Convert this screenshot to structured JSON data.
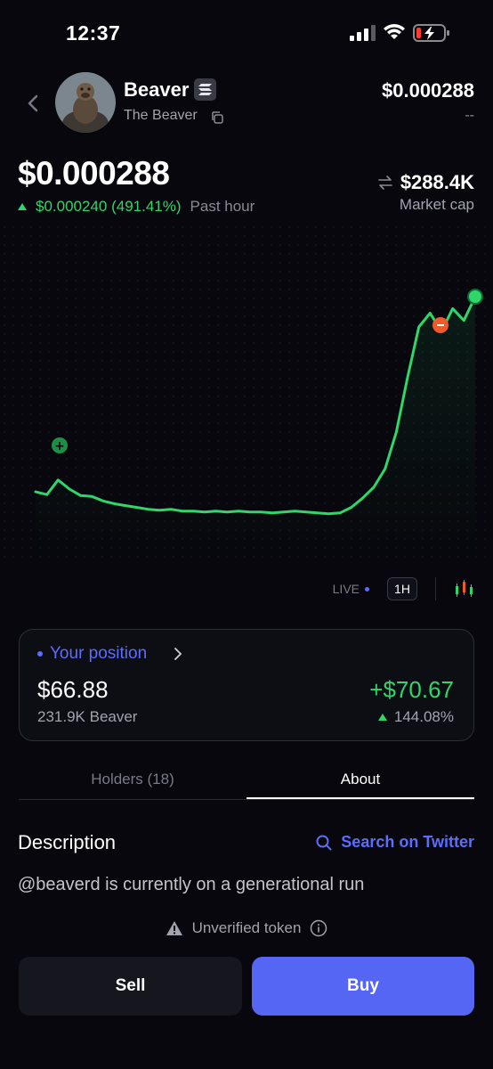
{
  "status_bar": {
    "time": "12:37"
  },
  "token": {
    "name": "Beaver",
    "subtitle": "The Beaver",
    "header_price": "$0.000288",
    "header_change": "--"
  },
  "price": {
    "value": "$0.000288",
    "change": "$0.000240 (491.41%)",
    "period": "Past hour",
    "market_cap": "$288.4K",
    "market_cap_label": "Market cap"
  },
  "chart_controls": {
    "live": "LIVE",
    "timeframe": "1H"
  },
  "position": {
    "title": "Your position",
    "value": "$66.88",
    "quantity": "231.9K Beaver",
    "pnl": "+$70.67",
    "pnl_pct": "144.08%"
  },
  "tabs": [
    {
      "label": "Holders (18)",
      "active": false
    },
    {
      "label": "About",
      "active": true
    }
  ],
  "about": {
    "title": "Description",
    "search_link": "Search on Twitter",
    "text": "@beaverd is currently on a generational run",
    "unverified": "Unverified token"
  },
  "actions": {
    "sell": "Sell",
    "buy": "Buy"
  },
  "colors": {
    "up": "#2fd66a",
    "accent": "#5566f5",
    "sell_marker": "#f05a2a"
  },
  "chart_data": {
    "type": "line",
    "y": [
      7.5e-05,
      7.2e-05,
      8.8e-05,
      7.8e-05,
      7.1e-05,
      7e-05,
      6.5e-05,
      6.2e-05,
      6e-05,
      5.8e-05,
      5.6e-05,
      5.5e-05,
      5.6e-05,
      5.4e-05,
      5.4e-05,
      5.3e-05,
      5.4e-05,
      5.3e-05,
      5.4e-05,
      5.3e-05,
      5.3e-05,
      5.2e-05,
      5.3e-05,
      5.4e-05,
      5.3e-05,
      5.2e-05,
      5.1e-05,
      5.2e-05,
      5.8e-05,
      6.8e-05,
      8e-05,
      0.0001,
      0.00014,
      0.0002,
      0.000255,
      0.00027,
      0.00025,
      0.000275,
      0.000262,
      0.000288
    ]
  }
}
